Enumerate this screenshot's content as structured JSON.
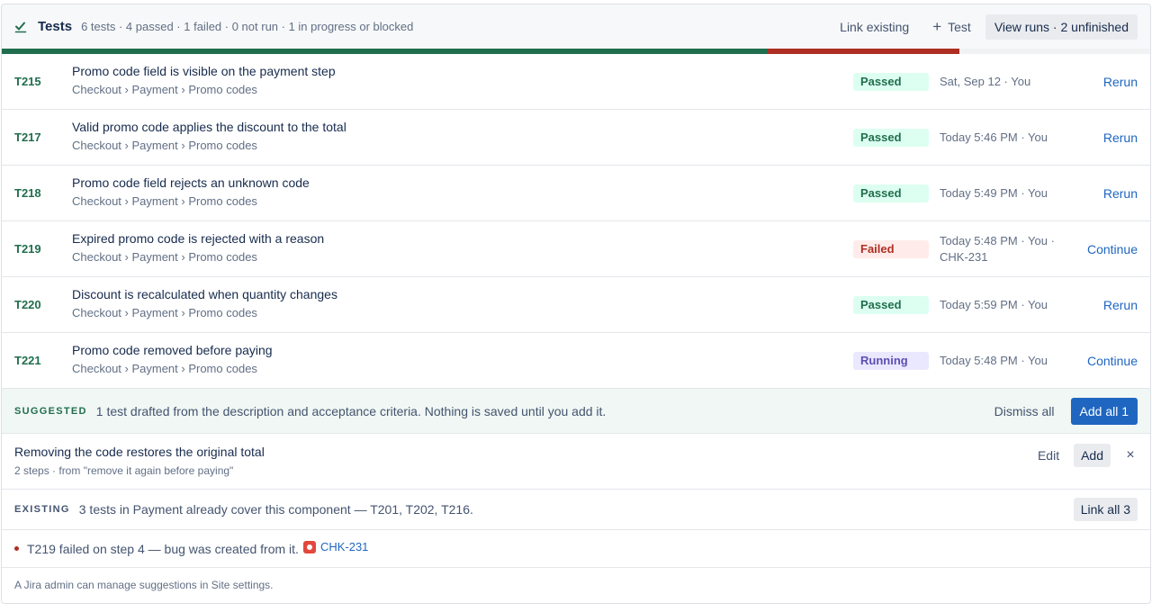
{
  "header": {
    "title": "Tests",
    "summary": "6 tests · 4 passed · 1 failed · 0 not run · 1 in progress or blocked",
    "link_existing": "Link existing",
    "add_test": "Test",
    "view_runs": "View runs · 2 unfinished",
    "icon": "check-icon",
    "progress": {
      "passed_fraction": 0.667,
      "failed_fraction": 0.167
    }
  },
  "tests": [
    {
      "id": "T215",
      "name": "Promo code field is visible on the payment step",
      "path": "Checkout › Payment › Promo codes",
      "status": "Passed",
      "status_key": "passed",
      "meta": "Sat, Sep 12 · You",
      "action": "Rerun"
    },
    {
      "id": "T217",
      "name": "Valid promo code applies the discount to the total",
      "path": "Checkout › Payment › Promo codes",
      "status": "Passed",
      "status_key": "passed",
      "meta": "Today 5:46 PM · You",
      "action": "Rerun"
    },
    {
      "id": "T218",
      "name": "Promo code field rejects an unknown code",
      "path": "Checkout › Payment › Promo codes",
      "status": "Passed",
      "status_key": "passed",
      "meta": "Today 5:49 PM · You",
      "action": "Rerun"
    },
    {
      "id": "T219",
      "name": "Expired promo code is rejected with a reason",
      "path": "Checkout › Payment › Promo codes",
      "status": "Failed",
      "status_key": "failed",
      "meta": "Today 5:48 PM · You · CHK-231",
      "action": "Continue"
    },
    {
      "id": "T220",
      "name": "Discount is recalculated when quantity changes",
      "path": "Checkout › Payment › Promo codes",
      "status": "Passed",
      "status_key": "passed",
      "meta": "Today 5:59 PM · You",
      "action": "Rerun"
    },
    {
      "id": "T221",
      "name": "Promo code removed before paying",
      "path": "Checkout › Payment › Promo codes",
      "status": "Running",
      "status_key": "running",
      "meta": "Today 5:48 PM · You",
      "action": "Continue"
    }
  ],
  "suggested": {
    "kicker": "SUGGESTED",
    "message": "1 test drafted from the description and acceptance criteria. Nothing is saved until you add it.",
    "dismiss_all": "Dismiss all",
    "add_all": "Add all 1",
    "item": {
      "name": "Removing the code restores the original total",
      "desc": "2 steps · from \"remove it again before paying\"",
      "edit": "Edit",
      "add": "Add",
      "close": "×"
    }
  },
  "existing": {
    "kicker": "EXISTING",
    "message": "3 tests in Payment already cover this component — T201, T202, T216.",
    "link_all": "Link all 3"
  },
  "bug": {
    "message": "T219 failed on step 4 — bug was created from it.",
    "link": "CHK-231"
  },
  "footer": {
    "text": "A Jira admin can manage suggestions in Site settings."
  },
  "colors": {
    "passed": "#216e4e",
    "failed": "#ae2e24",
    "running": "#5e4db2",
    "link": "#1f66c1"
  }
}
